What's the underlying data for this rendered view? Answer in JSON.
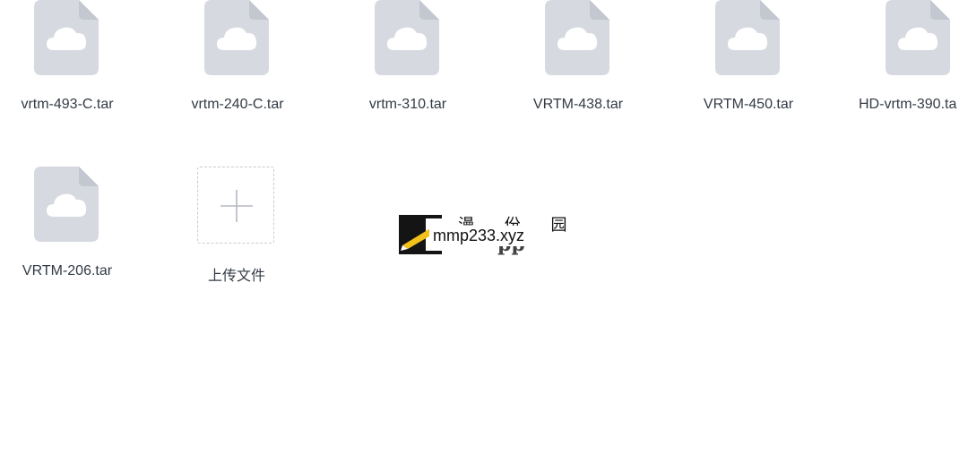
{
  "files": [
    {
      "name": "vrtm-493-C.tar",
      "icon": "cloud-file-icon"
    },
    {
      "name": "vrtm-240-C.tar",
      "icon": "cloud-file-icon"
    },
    {
      "name": "vrtm-310.tar",
      "icon": "cloud-file-icon"
    },
    {
      "name": "VRTM-438.tar",
      "icon": "cloud-file-icon"
    },
    {
      "name": "VRTM-450.tar",
      "icon": "cloud-file-icon"
    },
    {
      "name": "HD-vrtm-390.ta",
      "icon": "cloud-file-icon"
    },
    {
      "name": "VRTM-206.tar",
      "icon": "cloud-file-icon"
    }
  ],
  "upload": {
    "label": "上传文件",
    "icon": "plus-icon"
  },
  "watermark": {
    "text": "mmp233.xyz",
    "top_text": "漫 份 园",
    "app_text": "pp",
    "logo_icon": "pen-logo-icon"
  },
  "colors": {
    "file_icon_fill": "#d6d9e0",
    "cloud": "#ffffff",
    "text": "#333a45",
    "dashed_border": "#c7cbd3"
  }
}
